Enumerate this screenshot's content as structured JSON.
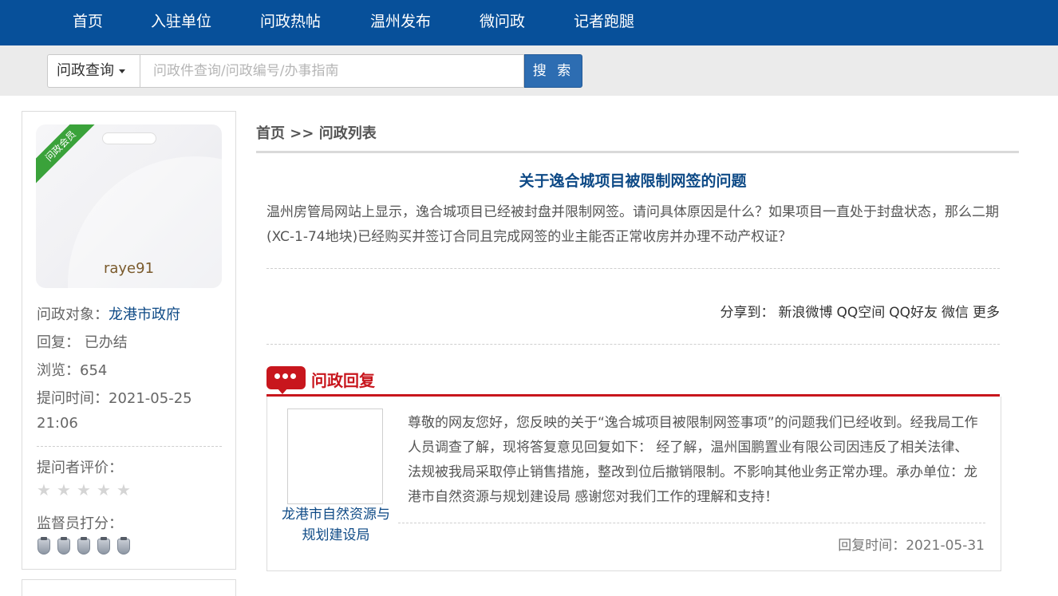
{
  "nav": {
    "items": [
      "首页",
      "入驻单位",
      "问政热帖",
      "温州发布",
      "微问政",
      "记者跑腿"
    ]
  },
  "search": {
    "select_label": "问政查询",
    "placeholder": "问政件查询/问政编号/办事指南",
    "button_label": "搜 索"
  },
  "profile": {
    "badge": "问政会员",
    "username": "raye91",
    "target_label": "问政对象：",
    "target_value": "龙港市政府",
    "reply_label": "回复：",
    "reply_value": "已办结",
    "views_label": "浏览：",
    "views_value": "654",
    "time_label": "提问时间：",
    "time_date": "2021-05-25",
    "time_clock": "21:06",
    "rating_label": "提问者评价：",
    "rating_stars": 0,
    "supervisor_label": "监督员打分："
  },
  "breadcrumb": {
    "home": "首页",
    "sep": " >> ",
    "current": "问政列表"
  },
  "question": {
    "title": "关于逸合城项目被限制网签的问题",
    "body": "温州房管局网站上显示，逸合城项目已经被封盘并限制网签。请问具体原因是什么？如果项目一直处于封盘状态，那么二期(XC-1-74地块)已经购买并签订合同且完成网签的业主能否正常收房并办理不动产权证？"
  },
  "share": {
    "label": "分享到：",
    "links": [
      "新浪微博",
      "QQ空间",
      "QQ好友",
      "微信",
      "更多"
    ]
  },
  "reply": {
    "heading": "问政回复",
    "org": "龙港市自然资源与规划建设局",
    "text": "尊敬的网友您好，您反映的关于“逸合城项目被限制网签事项”的问题我们已经收到。经我局工作人员调查了解，现将答复意见回复如下： 经了解，温州国鹏置业有限公司因违反了相关法律、法规被我局采取停止销售措施，整改到位后撤销限制。不影响其他业务正常办理。承办单位：龙港市自然资源与规划建设局 感谢您对我们工作的理解和支持！",
    "time": "回复时间：2021-05-31"
  },
  "colors": {
    "nav_bg": "#07509a",
    "accent_red": "#c8161d",
    "link_blue": "#0e4a86",
    "search_btn": "#2d6db2"
  }
}
